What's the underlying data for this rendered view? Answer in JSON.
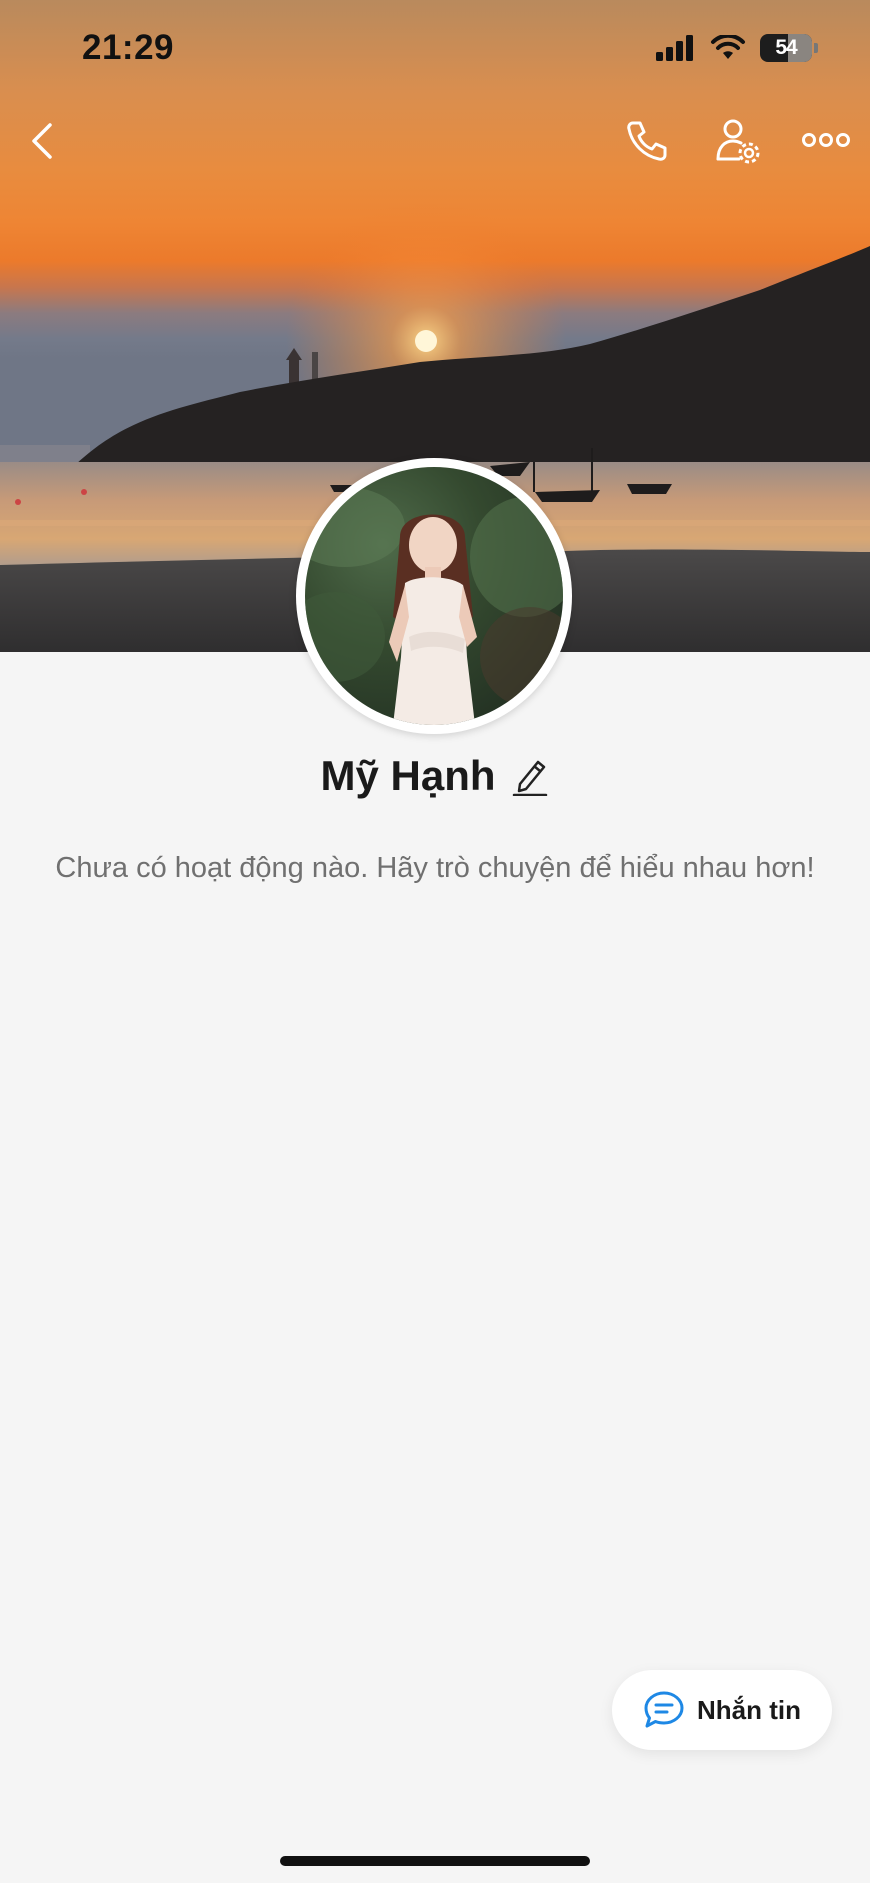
{
  "status_bar": {
    "time": "21:29",
    "battery_level": "54",
    "battery_fraction": 0.54
  },
  "header": {
    "back_icon": "chevron-left-icon",
    "call_icon": "phone-icon",
    "settings_icon": "user-settings-icon",
    "more_icon": "more-horizontal-icon"
  },
  "profile": {
    "name": "Mỹ Hạnh",
    "edit_icon": "pencil-icon",
    "empty_activity": "Chưa có hoạt động nào. Hãy trò chuyện để hiểu nhau hơn!"
  },
  "message_button": {
    "label": "Nhắn tin",
    "icon": "chat-bubble-icon",
    "accent": "#1e88e5"
  }
}
